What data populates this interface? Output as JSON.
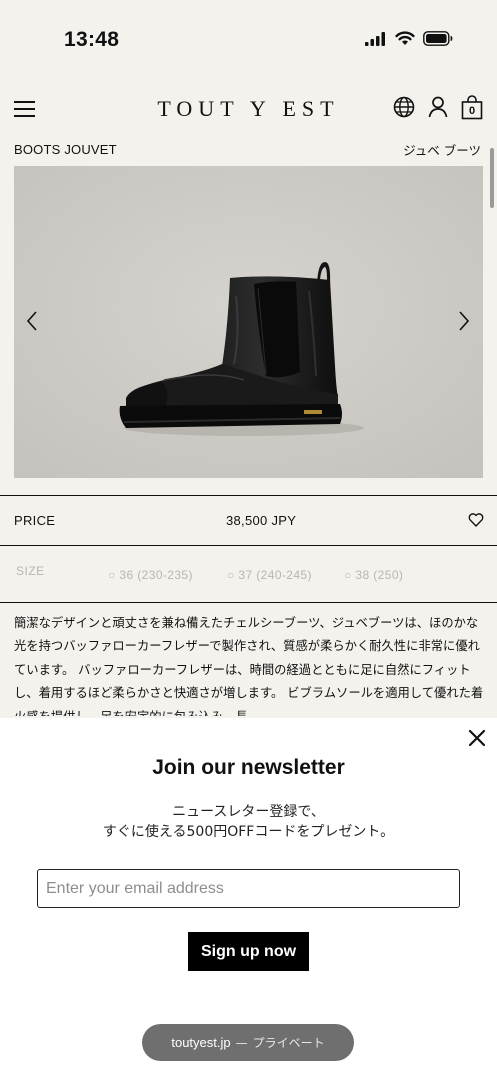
{
  "status_bar": {
    "time": "13:48",
    "icons": [
      "signal-icon",
      "wifi-icon",
      "battery-icon"
    ]
  },
  "header": {
    "logo": "TOUT Y EST",
    "cart_count": "0",
    "icons": [
      "menu-icon",
      "globe-icon",
      "account-icon",
      "cart-icon"
    ]
  },
  "product": {
    "name_en": "BOOTS JOUVET",
    "name_jp": "ジュベ ブーツ",
    "price_label": "PRICE",
    "price_value": "38,500 JPY",
    "size_label": "SIZE",
    "sizes": [
      "36 (230-235)",
      "37 (240-245)",
      "38 (250)"
    ],
    "description": "簡潔なデザインと頑丈さを兼ね備えたチェルシーブーツ、ジュベブーツは、ほのかな光を持つバッファローカーフレザーで製作され、質感が柔らかく耐久性に非常に優れています。 バッファローカーフレザーは、時間の経過とともに足に自然にフィットし、着用するほど柔らかさと快適さが増します。 ビブラムソールを適用して優れた着火感を提供し、足を安定的に包み込み、長"
  },
  "newsletter": {
    "title": "Join our newsletter",
    "subtitle_line1": "ニュースレター登録で、",
    "subtitle_line2": "すぐに使える500円OFFコードをプレゼント。",
    "email_placeholder": "Enter your email address",
    "button_label": "Sign up now"
  },
  "browser": {
    "url": "toutyest.jp",
    "separator": "—",
    "mode": "プライベート"
  },
  "colors": {
    "page_bg": "#f4f2ed",
    "image_bg": "#cfccc7",
    "accent": "#000000",
    "muted_text": "#b8b6b2"
  }
}
